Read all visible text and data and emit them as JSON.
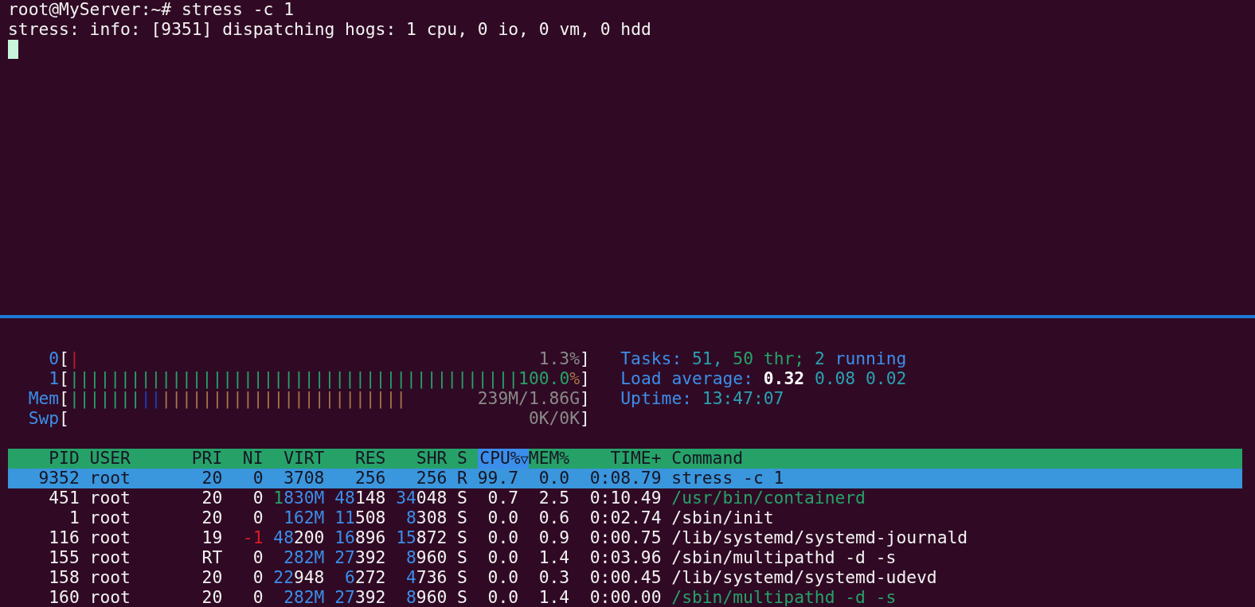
{
  "terminal": {
    "lines": [
      "root@MyServer:~# stress -c 1",
      "stress: info: [9351] dispatching hogs: 1 cpu, 0 io, 0 vm, 0 hdd"
    ],
    "cursor_visible": true
  },
  "htop": {
    "meters": [
      {
        "label": "0",
        "bracket_open": "[",
        "bracket_close": "]",
        "segments": [
          {
            "kind": "kernel",
            "text": "|"
          }
        ],
        "reading": [
          {
            "text": "1.3%",
            "kind": "dim"
          }
        ]
      },
      {
        "label": "1",
        "bracket_open": "[",
        "bracket_close": "]",
        "segments": [
          {
            "kind": "normal",
            "text": "||||||||||||||||||||||||||||||||||||||||||||"
          }
        ],
        "reading": [
          {
            "text": "100.0",
            "kind": "normal"
          },
          {
            "text": "%",
            "kind": "cache"
          }
        ]
      },
      {
        "label": "Mem",
        "bracket_open": "[",
        "bracket_close": "]",
        "segments": [
          {
            "kind": "used",
            "text": "|||||||"
          },
          {
            "kind": "buffers",
            "text": "||"
          },
          {
            "kind": "cache",
            "text": "||||||||||||||||||||||||"
          }
        ],
        "reading": [
          {
            "text": "239M/1.86G",
            "kind": "dim"
          }
        ]
      },
      {
        "label": "Swp",
        "bracket_open": "[",
        "bracket_close": "]",
        "reading": [
          {
            "text": "0K/0K",
            "kind": "dim"
          }
        ]
      }
    ],
    "info": [
      {
        "parts": [
          {
            "text": "Tasks: ",
            "kind": "label"
          },
          {
            "text": "51, ",
            "kind": "value"
          },
          {
            "text": "50 thr; ",
            "kind": "thread"
          },
          {
            "text": "2",
            "kind": "value"
          },
          {
            "text": " running",
            "kind": "label"
          }
        ]
      },
      {
        "parts": [
          {
            "text": "Load average: ",
            "kind": "label"
          },
          {
            "text": "0.32 ",
            "kind": "bright"
          },
          {
            "text": "0.08 ",
            "kind": "value"
          },
          {
            "text": "0.02",
            "kind": "value"
          }
        ]
      },
      {
        "parts": [
          {
            "text": "Uptime: ",
            "kind": "label"
          },
          {
            "text": "13:47:07",
            "kind": "value"
          }
        ]
      }
    ],
    "columns": [
      {
        "label": "PID",
        "selected": false
      },
      {
        "label": "USER",
        "selected": false
      },
      {
        "label": "PRI",
        "selected": false
      },
      {
        "label": "NI",
        "selected": false
      },
      {
        "label": "VIRT",
        "selected": false
      },
      {
        "label": "RES",
        "selected": false
      },
      {
        "label": "SHR",
        "selected": false
      },
      {
        "label": "S",
        "selected": false
      },
      {
        "label": "CPU%",
        "selected": true,
        "sort_indicator": "▽"
      },
      {
        "label": "MEM%",
        "selected": false
      },
      {
        "label": "TIME+",
        "selected": false
      },
      {
        "label": "Command",
        "selected": false
      }
    ],
    "rows": [
      {
        "selected": true,
        "cells": [
          "9352",
          "root",
          "20",
          "0",
          "3708",
          "256",
          "256",
          "R",
          "99.7",
          "0.0",
          "0:08.79",
          "stress -c 1"
        ]
      },
      {
        "selected": false,
        "cells": [
          "451",
          "root",
          "20",
          "0",
          {
            "parts": [
              {
                "text": "1",
                "kind": "giga"
              },
              {
                "text": "830M",
                "kind": "large"
              }
            ]
          },
          {
            "parts": [
              {
                "text": "48",
                "kind": "large"
              },
              {
                "text": "148",
                "kind": "plain"
              }
            ]
          },
          {
            "parts": [
              {
                "text": "34",
                "kind": "large"
              },
              {
                "text": "048",
                "kind": "plain"
              }
            ]
          },
          "S",
          "0.7",
          "2.5",
          "0:10.49",
          {
            "parts": [
              {
                "text": "/usr/bin/containerd",
                "kind": "thread"
              }
            ]
          }
        ]
      },
      {
        "selected": false,
        "cells": [
          "1",
          "root",
          "20",
          "0",
          {
            "parts": [
              {
                "text": "162M",
                "kind": "large"
              }
            ]
          },
          {
            "parts": [
              {
                "text": "11",
                "kind": "large"
              },
              {
                "text": "508",
                "kind": "plain"
              }
            ]
          },
          {
            "parts": [
              {
                "text": "8",
                "kind": "large"
              },
              {
                "text": "308",
                "kind": "plain"
              }
            ]
          },
          "S",
          "0.0",
          "0.6",
          "0:02.74",
          "/sbin/init"
        ]
      },
      {
        "selected": false,
        "cells": [
          "116",
          "root",
          "19",
          {
            "parts": [
              {
                "text": "-1",
                "kind": "neg"
              }
            ]
          },
          {
            "parts": [
              {
                "text": "48",
                "kind": "large"
              },
              {
                "text": "200",
                "kind": "plain"
              }
            ]
          },
          {
            "parts": [
              {
                "text": "16",
                "kind": "large"
              },
              {
                "text": "896",
                "kind": "plain"
              }
            ]
          },
          {
            "parts": [
              {
                "text": "15",
                "kind": "large"
              },
              {
                "text": "872",
                "kind": "plain"
              }
            ]
          },
          "S",
          "0.0",
          "0.9",
          "0:00.75",
          "/lib/systemd/systemd-journald"
        ]
      },
      {
        "selected": false,
        "cells": [
          "155",
          "root",
          "RT",
          "0",
          {
            "parts": [
              {
                "text": "282M",
                "kind": "large"
              }
            ]
          },
          {
            "parts": [
              {
                "text": "27",
                "kind": "large"
              },
              {
                "text": "392",
                "kind": "plain"
              }
            ]
          },
          {
            "parts": [
              {
                "text": "8",
                "kind": "large"
              },
              {
                "text": "960",
                "kind": "plain"
              }
            ]
          },
          "S",
          "0.0",
          "1.4",
          "0:03.96",
          "/sbin/multipathd -d -s"
        ]
      },
      {
        "selected": false,
        "cells": [
          "158",
          "root",
          "20",
          "0",
          {
            "parts": [
              {
                "text": "22",
                "kind": "large"
              },
              {
                "text": "948",
                "kind": "plain"
              }
            ]
          },
          {
            "parts": [
              {
                "text": "6",
                "kind": "large"
              },
              {
                "text": "272",
                "kind": "plain"
              }
            ]
          },
          {
            "parts": [
              {
                "text": "4",
                "kind": "large"
              },
              {
                "text": "736",
                "kind": "plain"
              }
            ]
          },
          "S",
          "0.0",
          "0.3",
          "0:00.45",
          "/lib/systemd/systemd-udevd"
        ]
      },
      {
        "selected": false,
        "cells": [
          "160",
          "root",
          "20",
          "0",
          {
            "parts": [
              {
                "text": "282M",
                "kind": "large"
              }
            ]
          },
          {
            "parts": [
              {
                "text": "27",
                "kind": "large"
              },
              {
                "text": "392",
                "kind": "plain"
              }
            ]
          },
          {
            "parts": [
              {
                "text": "8",
                "kind": "large"
              },
              {
                "text": "960",
                "kind": "plain"
              }
            ]
          },
          "S",
          "0.0",
          "1.4",
          "0:00.00",
          {
            "parts": [
              {
                "text": "/sbin/multipathd -d -s",
                "kind": "thread"
              }
            ]
          }
        ]
      }
    ]
  }
}
